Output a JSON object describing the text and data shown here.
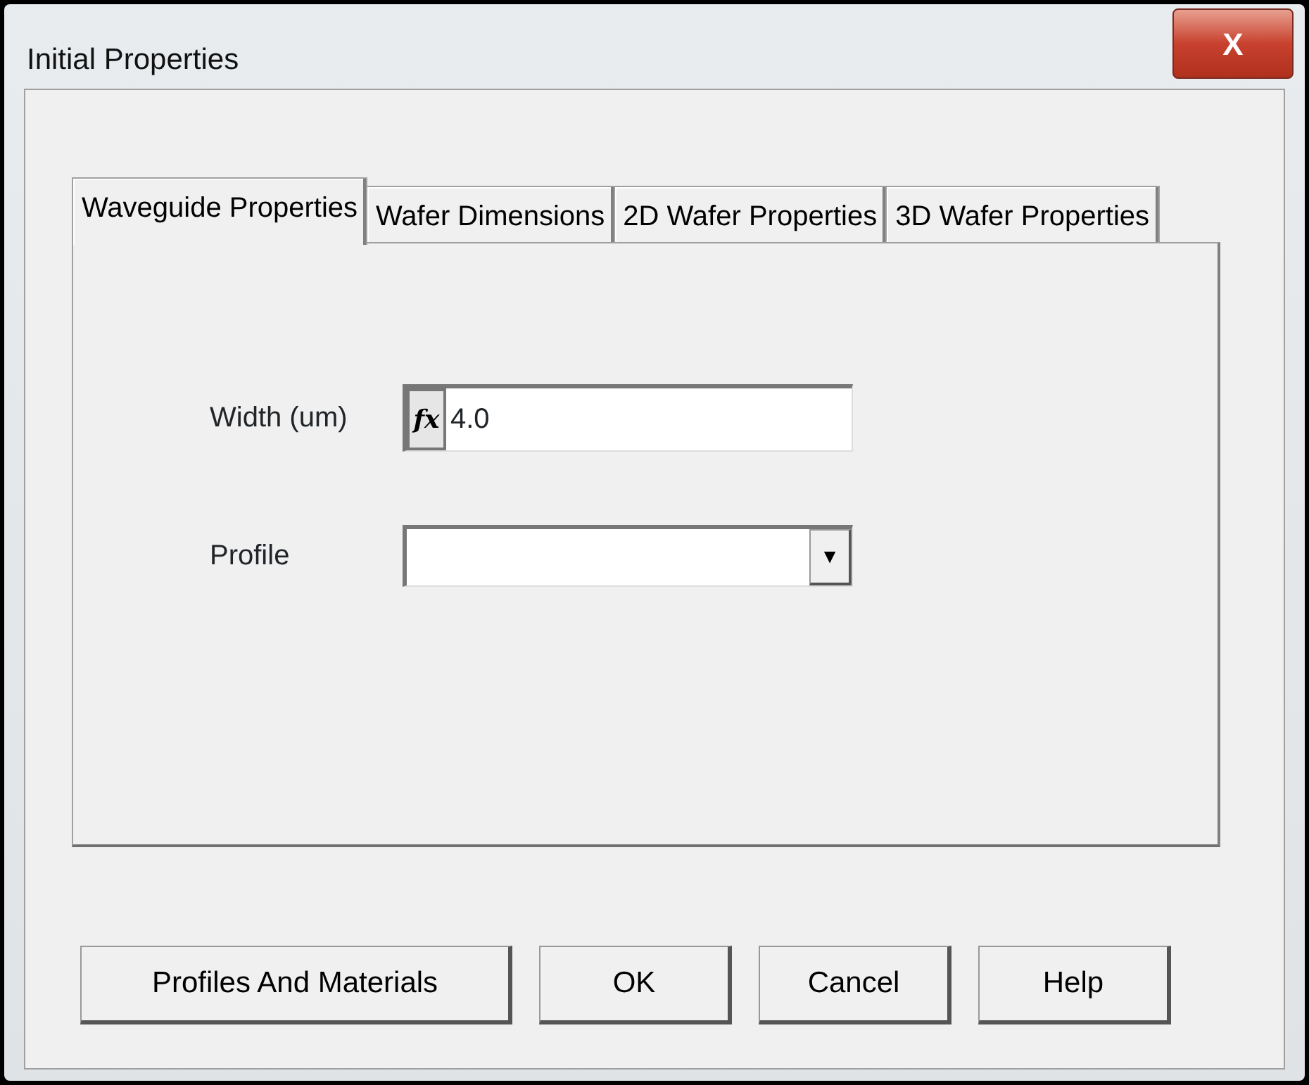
{
  "window": {
    "title": "Initial Properties",
    "close_label": "X"
  },
  "tabs": [
    {
      "label": "Waveguide Properties",
      "selected": true
    },
    {
      "label": "Wafer Dimensions",
      "selected": false
    },
    {
      "label": "2D Wafer Properties",
      "selected": false
    },
    {
      "label": "3D Wafer Properties",
      "selected": false
    }
  ],
  "fields": [
    {
      "kind": "formula",
      "label": "Width (um)",
      "formula_label": "fx",
      "value": "4.0"
    },
    {
      "kind": "dropdown",
      "label": "Profile",
      "arrow": "▼"
    }
  ],
  "buttons": [
    "Profiles And Materials",
    "OK",
    "Cancel",
    "Help"
  ]
}
